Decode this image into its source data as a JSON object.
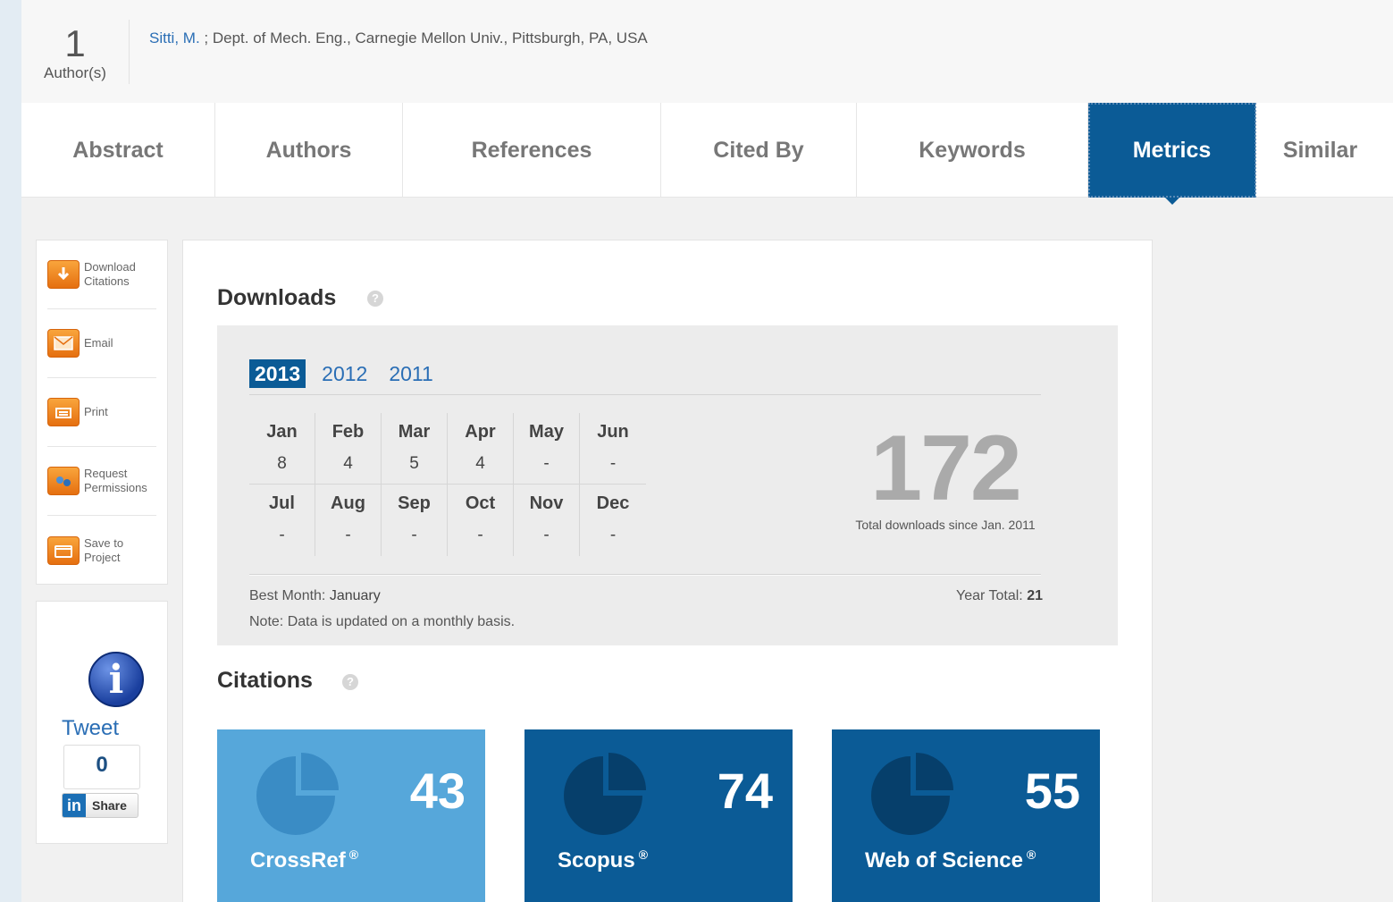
{
  "header": {
    "author_count": "1",
    "author_count_label": "Author(s)",
    "author_name": "Sitti, M.",
    "author_affiliation": " ; Dept. of Mech. Eng., Carnegie Mellon Univ., Pittsburgh, PA, USA"
  },
  "tabs": [
    {
      "label": "Abstract"
    },
    {
      "label": "Authors"
    },
    {
      "label": "References"
    },
    {
      "label": "Cited By"
    },
    {
      "label": "Keywords"
    },
    {
      "label": "Metrics",
      "active": true
    },
    {
      "label": "Similar"
    }
  ],
  "sidebar": {
    "items": [
      {
        "label_1": "Download",
        "label_2": "Citations",
        "icon": "download-icon"
      },
      {
        "label_1": "Email",
        "label_2": "",
        "icon": "email-icon"
      },
      {
        "label_1": "Print",
        "label_2": "",
        "icon": "print-icon"
      },
      {
        "label_1": "Request",
        "label_2": "Permissions",
        "icon": "permissions-icon"
      },
      {
        "label_1": "Save to",
        "label_2": "Project",
        "icon": "folder-icon"
      }
    ]
  },
  "social": {
    "tweet_label": "Tweet",
    "tweet_count": "0",
    "share_label": "Share",
    "linkedin_glyph": "in"
  },
  "downloads": {
    "title": "Downloads",
    "help_glyph": "?",
    "years": [
      "2013",
      "2012",
      "2011"
    ],
    "active_year": "2013",
    "months_row1": [
      {
        "name": "Jan",
        "value": "8"
      },
      {
        "name": "Feb",
        "value": "4"
      },
      {
        "name": "Mar",
        "value": "5"
      },
      {
        "name": "Apr",
        "value": "4"
      },
      {
        "name": "May",
        "value": "-"
      },
      {
        "name": "Jun",
        "value": "-"
      }
    ],
    "months_row2": [
      {
        "name": "Jul",
        "value": "-"
      },
      {
        "name": "Aug",
        "value": "-"
      },
      {
        "name": "Sep",
        "value": "-"
      },
      {
        "name": "Oct",
        "value": "-"
      },
      {
        "name": "Nov",
        "value": "-"
      },
      {
        "name": "Dec",
        "value": "-"
      }
    ],
    "total": "172",
    "total_caption": "Total downloads since Jan. 2011",
    "best_month_label": "Best Month:",
    "best_month_value": "January",
    "year_total_label": "Year Total:",
    "year_total_value": "21",
    "note": "Note: Data is updated on a monthly basis."
  },
  "citations": {
    "title": "Citations",
    "help_glyph": "?",
    "cards": [
      {
        "source": "CrossRef",
        "count": "43",
        "color": "#56a7da",
        "pie_color": "#3a8cc5"
      },
      {
        "source": "Scopus",
        "count": "74",
        "color": "#0b5b96",
        "pie_color": "#063f6b"
      },
      {
        "source": "Web of Science",
        "count": "55",
        "color": "#0b5b96",
        "pie_color": "#063f6b"
      }
    ],
    "registered_mark": "®"
  },
  "colors": {
    "accent": "#0b5b96",
    "link": "#2a6eb5",
    "sidebar_icon": "#f28a1e"
  }
}
